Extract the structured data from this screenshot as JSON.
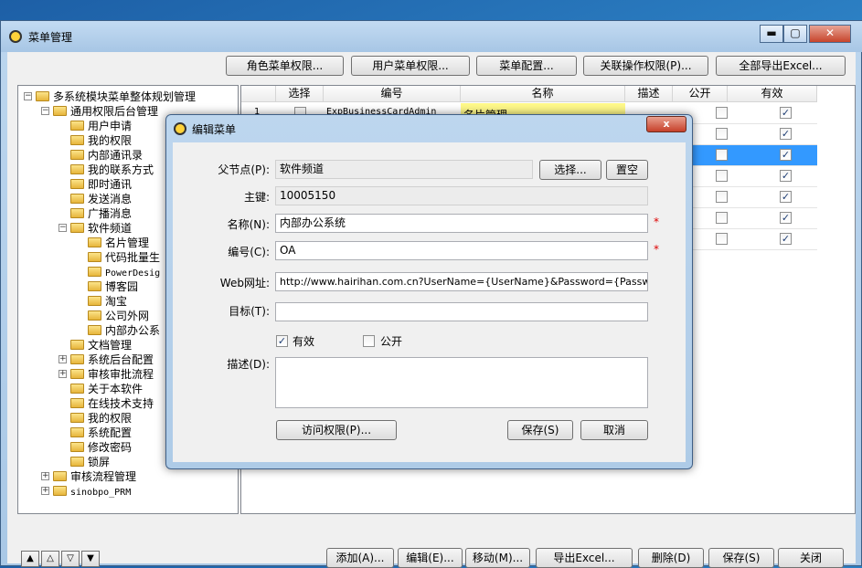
{
  "window": {
    "title": "菜单管理",
    "min": "▬",
    "max": "▢",
    "close": "✕"
  },
  "toolbar": {
    "role_menu_perm": "角色菜单权限...",
    "user_menu_perm": "用户菜单权限...",
    "menu_config": "菜单配置...",
    "related_ops_perm": "关联操作权限(P)...",
    "export_all_excel": "全部导出Excel..."
  },
  "tree": [
    {
      "label": "多系统模块菜单整体规划管理",
      "expander": "−"
    },
    {
      "label": "通用权限后台管理",
      "expander": "−"
    },
    {
      "label": "用户申请"
    },
    {
      "label": "我的权限"
    },
    {
      "label": "内部通讯录"
    },
    {
      "label": "我的联系方式"
    },
    {
      "label": "即时通讯"
    },
    {
      "label": "发送消息"
    },
    {
      "label": "广播消息"
    },
    {
      "label": "软件频道",
      "expander": "−"
    },
    {
      "label": "名片管理"
    },
    {
      "label": "代码批量生"
    },
    {
      "label": "PowerDesig"
    },
    {
      "label": "博客园"
    },
    {
      "label": "淘宝"
    },
    {
      "label": "公司外网"
    },
    {
      "label": "内部办公系"
    },
    {
      "label": "文档管理"
    },
    {
      "label": "系统后台配置",
      "expander": "+"
    },
    {
      "label": "审核审批流程",
      "expander": "+"
    },
    {
      "label": "关于本软件"
    },
    {
      "label": "在线技术支持"
    },
    {
      "label": "我的权限"
    },
    {
      "label": "系统配置"
    },
    {
      "label": "修改密码"
    },
    {
      "label": "锁屏"
    },
    {
      "label": "审核流程管理",
      "expander": "+"
    },
    {
      "label": "sinobpo_PRM",
      "expander": "+"
    }
  ],
  "grid": {
    "columns": [
      "选择",
      "编号",
      "名称",
      "描述",
      "公开",
      "有效"
    ],
    "rows": [
      {
        "num": "1",
        "code": "ExpBusinessCardAdmin",
        "name": "名片管理"
      },
      {
        "num": "",
        "code": "",
        "name": ""
      },
      {
        "num": "",
        "code": "",
        "name": ""
      },
      {
        "num": "",
        "code": "",
        "name": ""
      },
      {
        "num": "",
        "code": "",
        "name": ""
      },
      {
        "num": "",
        "code": "",
        "name": ""
      },
      {
        "num": "",
        "code": "",
        "name": ""
      }
    ]
  },
  "bottom": {
    "add": "添加(A)...",
    "edit": "编辑(E)...",
    "move": "移动(M)...",
    "export_excel": "导出Excel...",
    "delete": "删除(D)",
    "save": "保存(S)",
    "close": "关闭",
    "nav": [
      "▲",
      "△",
      "▽",
      "▼"
    ]
  },
  "dialog": {
    "title": "编辑菜单",
    "close": "x",
    "parent_label": "父节点(P):",
    "parent_value": "软件频道",
    "select_btn": "选择...",
    "clear_btn": "置空",
    "key_label": "主键:",
    "key_value": "10005150",
    "name_label": "名称(N):",
    "name_value": "内部办公系统",
    "code_label": "编号(C):",
    "code_value": "OA",
    "url_label": "Web网址:",
    "url_value": "http://www.hairihan.com.cn?UserName={UserName}&Password={Password}",
    "target_label": "目标(T):",
    "target_value": "",
    "valid_label": "有效",
    "public_label": "公开",
    "desc_label": "描述(D):",
    "desc_value": "",
    "access_btn": "访问权限(P)...",
    "save_btn": "保存(S)",
    "cancel_btn": "取消",
    "required_mark": "*"
  }
}
